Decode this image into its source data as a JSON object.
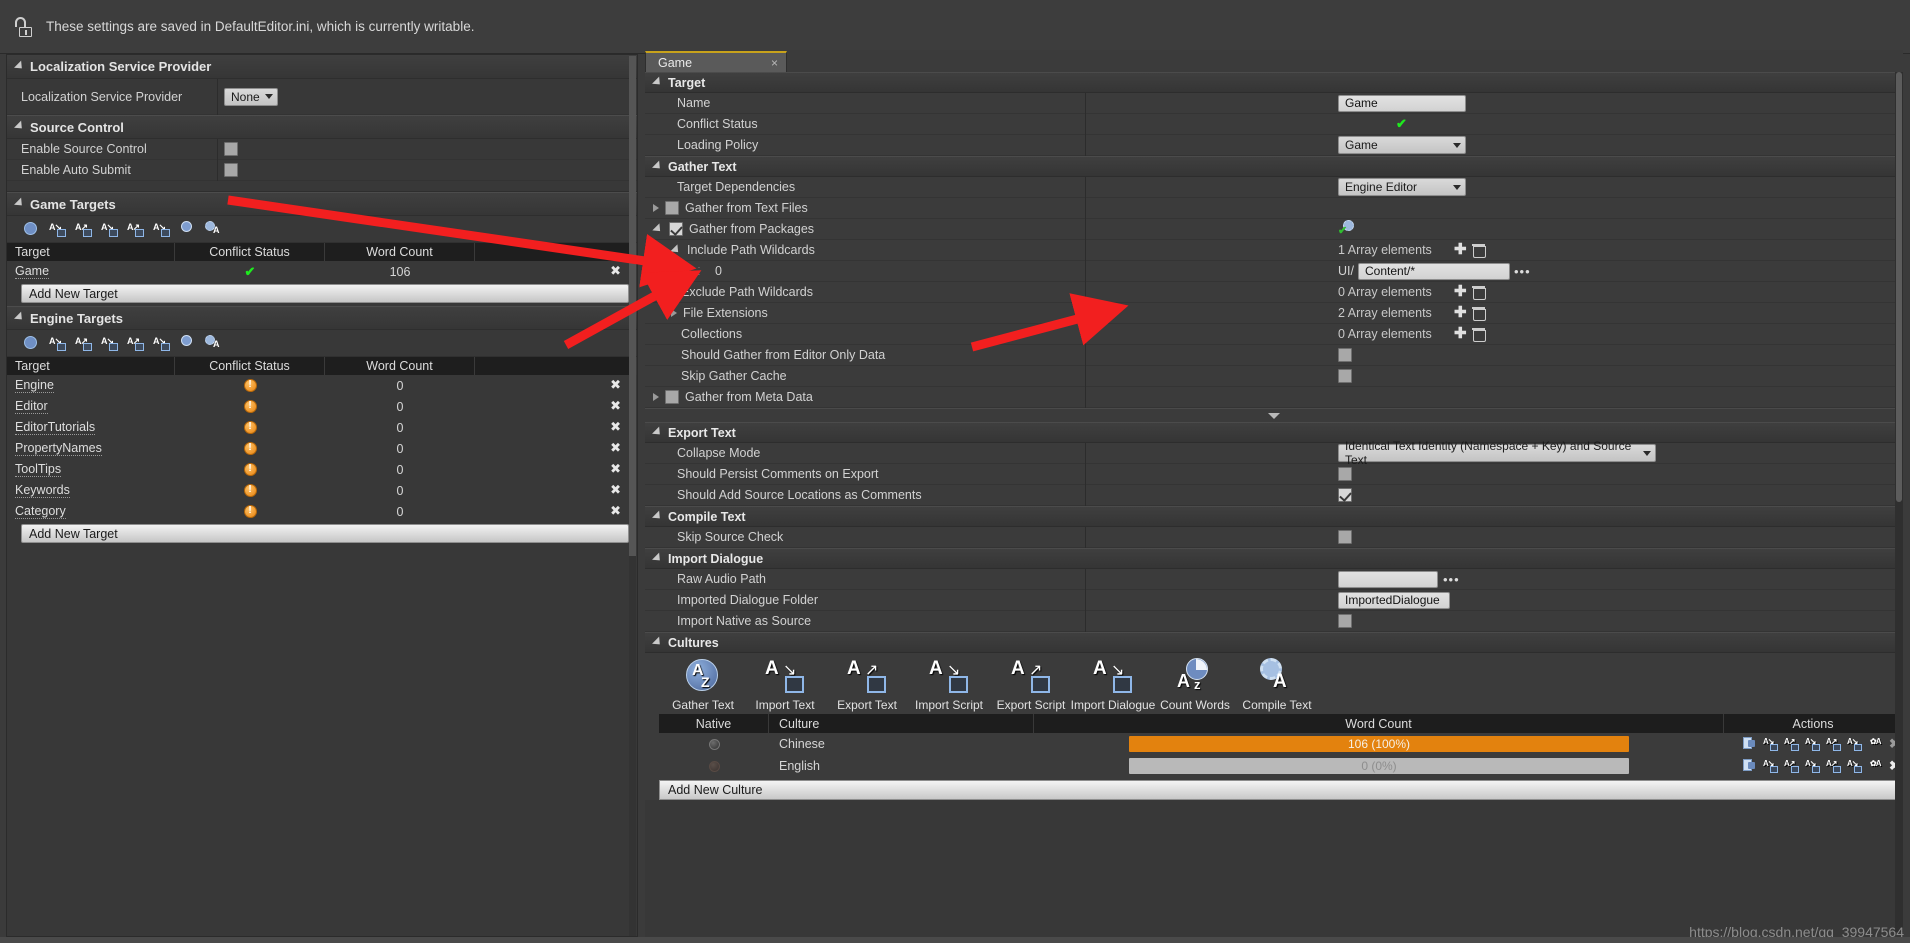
{
  "notice": {
    "icon": "unlock-icon",
    "text": "These settings are saved in DefaultEditor.ini, which is currently writable."
  },
  "left": {
    "sections": [
      {
        "title": "Localization Service Provider"
      },
      {
        "title": "Source Control"
      },
      {
        "title": "Game Targets"
      },
      {
        "title": "Engine Targets"
      }
    ],
    "lsp": {
      "label": "Localization Service Provider",
      "value": "None"
    },
    "source_control": {
      "rows": [
        {
          "label": "Enable Source Control",
          "checked": false
        },
        {
          "label": "Enable Auto Submit",
          "checked": false
        }
      ]
    },
    "table_columns": [
      "Target",
      "Conflict Status",
      "Word Count",
      ""
    ],
    "toolbar_icons": [
      "gather-text-icon",
      "import-text-icon",
      "export-text-icon",
      "import-script-icon",
      "export-script-icon",
      "import-dialogue-icon",
      "count-words-icon",
      "compile-text-icon"
    ],
    "game_targets": {
      "rows": [
        {
          "target": "Game",
          "conflict": "ok",
          "words": "106"
        }
      ],
      "add_label": "Add New Target"
    },
    "engine_targets": {
      "rows": [
        {
          "target": "Engine",
          "conflict": "warn",
          "words": "0"
        },
        {
          "target": "Editor",
          "conflict": "warn",
          "words": "0"
        },
        {
          "target": "EditorTutorials",
          "conflict": "warn",
          "words": "0"
        },
        {
          "target": "PropertyNames",
          "conflict": "warn",
          "words": "0"
        },
        {
          "target": "ToolTips",
          "conflict": "warn",
          "words": "0"
        },
        {
          "target": "Keywords",
          "conflict": "warn",
          "words": "0"
        },
        {
          "target": "Category",
          "conflict": "warn",
          "words": "0"
        }
      ],
      "add_label": "Add New Target"
    }
  },
  "right": {
    "tab": {
      "label": "Game",
      "close": "×"
    },
    "target_section": {
      "title": "Target",
      "name_label": "Name",
      "name_value": "Game",
      "conflict_label": "Conflict Status",
      "conflict_value": "ok",
      "loading_label": "Loading Policy",
      "loading_value": "Game"
    },
    "gather_text": {
      "title": "Gather Text",
      "target_dependencies_label": "Target Dependencies",
      "target_dependencies_value": "Engine    Editor",
      "gather_text_files_label": "Gather from Text Files",
      "gather_text_files_checked": false,
      "gather_packages_label": "Gather from Packages",
      "gather_packages_checked": true,
      "include_path_label": "Include Path Wildcards",
      "include_path_count": "1 Array elements",
      "include_index": "0",
      "include_prefix": "UI/",
      "include_value": "Content/*",
      "exclude_path_label": "Exclude Path Wildcards",
      "exclude_path_count": "0 Array elements",
      "file_ext_label": "File Extensions",
      "file_ext_count": "2 Array elements",
      "collections_label": "Collections",
      "collections_count": "0 Array elements",
      "editor_only_label": "Should Gather from Editor Only Data",
      "editor_only_checked": false,
      "skip_cache_label": "Skip Gather Cache",
      "skip_cache_checked": false,
      "meta_data_label": "Gather from Meta Data",
      "meta_data_checked": false
    },
    "export_text": {
      "title": "Export Text",
      "collapse_label": "Collapse Mode",
      "collapse_value": "Identical Text Identity (Namespace + Key) and Source Text",
      "persist_label": "Should Persist Comments on Export",
      "persist_checked": false,
      "source_loc_label": "Should Add Source Locations as Comments",
      "source_loc_checked": true
    },
    "compile_text": {
      "title": "Compile Text",
      "skip_source_label": "Skip Source Check",
      "skip_source_checked": false
    },
    "import_dialogue": {
      "title": "Import Dialogue",
      "raw_audio_label": "Raw Audio Path",
      "raw_audio_value": "",
      "imported_folder_label": "Imported Dialogue Folder",
      "imported_folder_value": "ImportedDialogue",
      "native_source_label": "Import Native as Source",
      "native_source_checked": false
    },
    "cultures": {
      "title": "Cultures",
      "actions": [
        {
          "label": "Gather Text",
          "icon": "gather-text-icon"
        },
        {
          "label": "Import Text",
          "icon": "import-text-icon"
        },
        {
          "label": "Export Text",
          "icon": "export-text-icon"
        },
        {
          "label": "Import Script",
          "icon": "import-script-icon"
        },
        {
          "label": "Export Script",
          "icon": "export-script-icon"
        },
        {
          "label": "Import Dialogue",
          "icon": "import-dialogue-icon"
        },
        {
          "label": "Count Words",
          "icon": "count-words-icon"
        },
        {
          "label": "Compile Text",
          "icon": "compile-text-icon"
        }
      ],
      "columns": [
        "Native",
        "Culture",
        "Word Count",
        "Actions"
      ],
      "rows": [
        {
          "native": true,
          "culture": "Chinese",
          "word_count": "106 (100%)",
          "percent": 100
        },
        {
          "native": false,
          "culture": "English",
          "word_count": "0 (0%)",
          "percent": 0
        }
      ],
      "add_label": "Add New Culture"
    }
  },
  "colors": {
    "progress_full": "#e3820e",
    "progress_empty": "#b9b9b9",
    "ok_check": "#1eea1e",
    "warn": "#e8820e",
    "tab_accent": "#c8a21b",
    "annotation_arrow": "#f21f1f"
  },
  "watermark": "https://blog.csdn.net/qq_39947564"
}
